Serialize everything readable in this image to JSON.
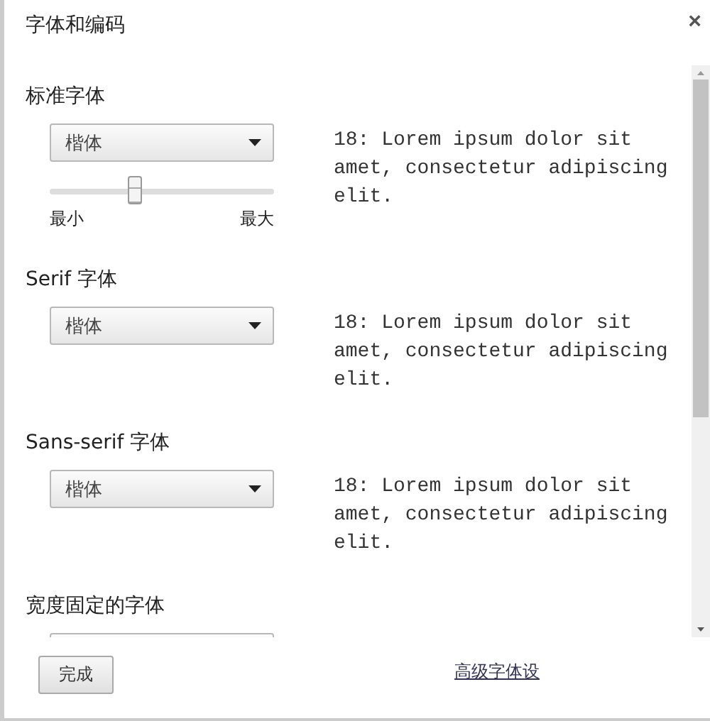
{
  "dialog": {
    "title": "字体和编码",
    "close": "×"
  },
  "sections": [
    {
      "label": "标准字体",
      "font": "楷体",
      "sample": "18: Lorem ipsum dolor sit amet, consectetur adipiscing elit.",
      "size_slider": {
        "level": 0.38,
        "min_label": "最小",
        "max_label": "最大"
      }
    },
    {
      "label": "Serif 字体",
      "font": "楷体",
      "sample": "18: Lorem ipsum dolor sit amet, consectetur adipiscing elit."
    },
    {
      "label": "Sans-serif 字体",
      "font": "楷体",
      "sample": "18: Lorem ipsum dolor sit amet, consectetur adipiscing elit."
    },
    {
      "label": "宽度固定的字体"
    }
  ],
  "footer": {
    "done_button": "完成",
    "advanced_link": "高级字体设"
  }
}
